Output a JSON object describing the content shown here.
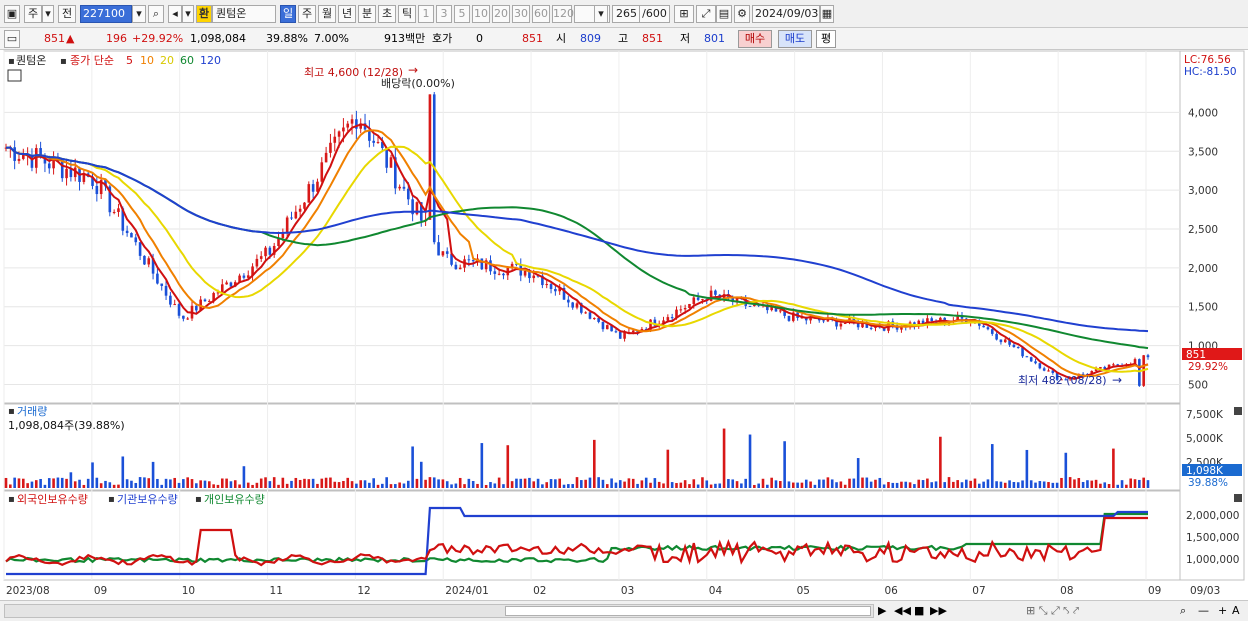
{
  "toolbar": {
    "market_btn": "주",
    "prev_btn": "전",
    "code": "227100",
    "name_badge": "환",
    "stock_name": "퀀텀온",
    "periods": [
      "일",
      "주",
      "월",
      "년",
      "분",
      "초",
      "틱"
    ],
    "active_period": "일",
    "intervals": [
      "1",
      "3",
      "5",
      "10",
      "20",
      "30",
      "60",
      "120"
    ],
    "count": "265",
    "count_max": "/600",
    "date": "2024/09/03"
  },
  "info": {
    "price": "851",
    "change": "196",
    "change_pct": "+29.92%",
    "volume": "1,098,084",
    "vol_pct": "39.88%",
    "extra_pct": "7.00%",
    "amount": "913백만",
    "quote_label": "호가",
    "quote_value": "0",
    "quote_price": "851",
    "open_label": "시",
    "open_value": "809",
    "high_label": "고",
    "high_value": "851",
    "low_label": "저",
    "low_value": "801",
    "buy_btn": "매수",
    "sell_btn": "매도",
    "eval_btn": "평"
  },
  "price_panel": {
    "title": "퀀텀온",
    "legend_prefix": "종가 단순",
    "ma_labels": [
      "5",
      "10",
      "20",
      "60",
      "120"
    ],
    "ma_colors": [
      "#d01010",
      "#f08000",
      "#e8d800",
      "#108830",
      "#2040d0"
    ],
    "high_annot": "최고 4,600 (12/28)",
    "dividend_annot": "배당락(0.00%)",
    "low_annot": "최저 482 (08/28)",
    "lc": "LC:76.56",
    "hc": "HC:-81.50",
    "price_tag": "851",
    "pct_tag": "29.92%",
    "y_ticks": [
      "4,000",
      "3,500",
      "3,000",
      "2,500",
      "2,000",
      "1,500",
      "1,000",
      "500"
    ]
  },
  "volume_panel": {
    "title": "거래량",
    "subtitle": "1,098,084주(39.88%)",
    "y_ticks": [
      "7,500K",
      "5,000K",
      "2,500K"
    ],
    "vol_tag": "1,098K",
    "vol_pct_tag": "39.88%"
  },
  "holding_panel": {
    "legend": [
      "외국인보유수량",
      "기관보유수량",
      "개인보유수량"
    ],
    "legend_colors": [
      "#d01010",
      "#2040d0",
      "#108830"
    ],
    "y_ticks": [
      "2,000,000",
      "1,500,000",
      "1,000,000"
    ]
  },
  "x_axis": {
    "labels": [
      "2023/08",
      "09",
      "10",
      "11",
      "12",
      "2024/01",
      "02",
      "03",
      "04",
      "05",
      "06",
      "07",
      "08",
      "09"
    ],
    "right_label": "09/03"
  },
  "chart_data": {
    "type": "candlestick",
    "note_ma": "moving averages 5/10/20/60/120",
    "ylim": [
      300,
      4700
    ],
    "monthly_closes": [
      {
        "month": "2023/08",
        "value": 3550
      },
      {
        "month": "09",
        "value": 3150
      },
      {
        "month": "10",
        "value": 1350
      },
      {
        "month": "11",
        "value": 2200
      },
      {
        "month": "12",
        "value": 4000
      },
      {
        "month": "2024/01",
        "value": 2100
      },
      {
        "month": "02",
        "value": 1950
      },
      {
        "month": "03",
        "value": 1100
      },
      {
        "month": "04",
        "value": 1650
      },
      {
        "month": "05",
        "value": 1350
      },
      {
        "month": "06",
        "value": 1250
      },
      {
        "month": "07",
        "value": 1350
      },
      {
        "month": "08",
        "value": 560
      },
      {
        "month": "09",
        "value": 851
      }
    ],
    "high": {
      "value": 4600,
      "date": "12/28"
    },
    "low": {
      "value": 482,
      "date": "08/28"
    },
    "last": 851
  }
}
